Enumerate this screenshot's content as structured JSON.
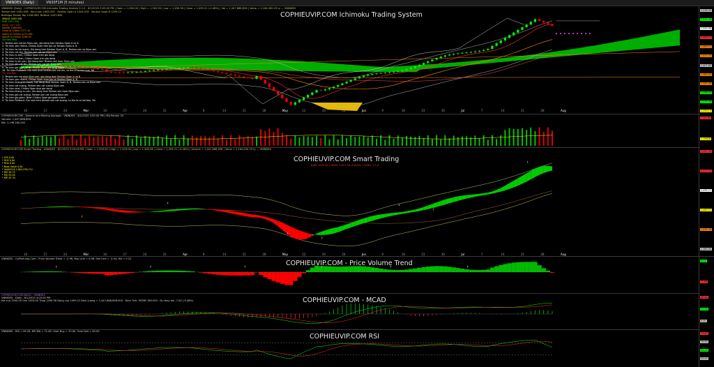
{
  "tabs": [
    "VNINDEX (Daily)",
    "VN30F1M (5 minutes)"
  ],
  "panels": {
    "ichimoku": {
      "watermark": "COPHIEUVIP.COM Ichimoku Trading System",
      "header": [
        "VNINDEX (Daily) - COPHIEUVIP.COM Ichimoku Trading System 9.1.0 - 8/1/2025 3:05:00 PM | Open = 1,500.00 | High = 1,503.00 | Low = 1,490.56 | Close = 1,495.21 (-0.48%) | Vol = 1,447,888,856 | Value = 2,164,000.25 ty — VNINDEX",
        "Tenkan-sen 1500.556   Kijun-sen 1463.505   Senkou Span A 1343.476   Senkou Span B 1250.13",
        "Bollinger Bands Top 1538.989  Bottom 1407.845"
      ],
      "legend": [
        {
          "text": "SMA20 1463.336",
          "color": "#ffff00"
        },
        {
          "text": "EMA 1511.338",
          "color": "#00ff00"
        },
        {
          "text": "MA50 1417.434",
          "color": "#ff4040"
        },
        {
          "text": "MA200 1360.645",
          "color": "#ff8c00"
        },
        {
          "text": "Close Al Chikou 1377.44",
          "color": "#ff8c00"
        },
        {
          "text": "Spann Al Chikou 1271.585",
          "color": "#ff8c00"
        },
        {
          "text": "SpanB Al Chikou 1298.35",
          "color": "#ff8c00"
        },
        {
          "text": "Tin hieu Mua",
          "color": "#00ff00"
        },
        {
          "text": "1. Tenkan-sen cat len Kijun-sen, gia dong tren Senkou Span A va B",
          "color": "#ffffff"
        },
        {
          "text": "2. Tin hieu yeu nhanh, Chikou Span tren gia va Senkou Span A, B",
          "color": "#ffffff"
        },
        {
          "text": "3. Tin hieu ho tro manh, Gia dong tren Senkou Span A, B, Tenkan-sen va Kijun-sen",
          "color": "#ffffff"
        },
        {
          "text": "4. Tin hieu cat len, Tenkan-sen cat len Kijun-sen",
          "color": "#ffffff"
        },
        {
          "text": "5. Tin hieu tu tren, Chikou Span tren gia dong",
          "color": "#ffffff"
        },
        {
          "text": "6. Tin hieu tru tien, Chikou Span tren gia dong",
          "color": "#ffffff"
        },
        {
          "text": "7. Tin hieu tu tru yeu, Gia dong tren Tenkan-sen hoac Kijun-sen",
          "color": "#ffffff"
        },
        {
          "text": "8. Tin hieu gia cat len, Tenkan-sen cat len Kijun-sen",
          "color": "#ffffff"
        },
        {
          "text": "9. Tin hieu gia vuot, Nhan Chikou Span gia tang manh",
          "color": "#ffffff"
        },
        {
          "text": "10. Tin hieu Pullback: Gia nam duoi tenkan-sen cat len, co the la co hoi mua, No",
          "color": "#ffffff"
        },
        {
          "text": "Tin hieu Ban",
          "color": "#ff3030"
        },
        {
          "text": "1. Tenkan-sen cat duoi Kijun-sen, gia dong duoi Senkou Span A va B",
          "color": "#ffffff"
        },
        {
          "text": "2. Tin hieu yeu nhanh, Chikou Span duoi gia va Senkou Span A, B",
          "color": "#ffffff"
        },
        {
          "text": "3. Tin hieu khang cu manh, Gia dong duoi Senkou Span A, B, Tenkan-sen va Kijun-sen",
          "color": "#ffffff"
        },
        {
          "text": "4. Tin hieu cat xuong, Tenkan-sen cat xuong Kijun-sen",
          "color": "#ffffff"
        },
        {
          "text": "5. Tin hieu duoi, Chikou Span duoi gia dong",
          "color": "#ffffff"
        },
        {
          "text": "6. Tin hieu khang cu yeu, Gia dong duoi Tenkan-sen hoac Kijun-sen",
          "color": "#ffffff"
        },
        {
          "text": "7. Tin hieu gia cat xuong, Tenkan-sen cat xuong Kijun-sen",
          "color": "#ffffff"
        },
        {
          "text": "8. Tin hieu gia giam, Nhan Chikou Span gia giam manh",
          "color": "#ffffff"
        },
        {
          "text": "9. Tin hieu Pullback: Gia nam tren tenkan-sen cat xuong, co the la co hoi ban, No",
          "color": "#ffffff"
        }
      ],
      "price_labels": [
        {
          "text": "1,538.99",
          "color": "#c0c0c0"
        },
        {
          "text": "1,511.34",
          "color": "#00ff00"
        },
        {
          "text": "1,500.56",
          "color": "#ffffff"
        },
        {
          "text": "1,495.21",
          "color": "#ff3030"
        },
        {
          "text": "1,463.51",
          "color": "#ff8c00"
        },
        {
          "text": "1,417.43",
          "color": "#ff8c00"
        },
        {
          "text": "1,407.85",
          "color": "#c0c0c0"
        },
        {
          "text": "1,360.65",
          "color": "#ff8c00"
        },
        {
          "text": "1,343.48",
          "color": "#ff8c00"
        },
        {
          "text": "1,298.35",
          "color": "#00ff00"
        },
        {
          "text": "1,271.59",
          "color": "#00ff00"
        },
        {
          "text": "1,250.13",
          "color": "#ffff00"
        }
      ]
    },
    "volume": {
      "header": "COPHIEUVIP.COM - Volume and Moving Average - VNINDEX - 8/1/2025 3:05:00 PM | MA Period: 20",
      "line2": "Volume: 1,447,888,856",
      "line3": "MA: 1,196,180,002",
      "labels": [
        {
          "text": "1.4478B",
          "color": "#ff3030"
        },
        {
          "text": "1.1962B",
          "color": "#ffff00"
        }
      ]
    },
    "smart": {
      "watermark": "COPHIEUVIP.COM Smart Trading",
      "subtitle": "BAN: 1525.45 | GIAM: 1,517.54 (9 diem) | LANH: 1,5,5",
      "header": "COPHIEUVIP.COM Smart Trading - VNINDEX - 8/1/2025 3:05:00 PM | Open = 1,500.00 | High = 1,503.00 | Low = 1,490.56 | Close = 1,495.21 (-0.48%) | Volume = 1,447,888,856 | Value = 2,164,000.25 ty — VNINDEX",
      "stats": [
        {
          "text": "* EPS   0.00",
          "color": "#ffff00"
        },
        {
          "text": "* ROE   0.00",
          "color": "#ffff00"
        },
        {
          "text": "* ROA   0.00",
          "color": "#ffff00"
        },
        {
          "text": "* Book Value   0.00",
          "color": "#ffff00"
        },
        {
          "text": "* VolAVG20  1,602,976,712",
          "color": "#ffff00"
        },
        {
          "text": "* MFI   61.72",
          "color": "#ffff00"
        },
        {
          "text": "* RSI   59.28",
          "color": "#ffff00"
        },
        {
          "text": "* MFI   67.34",
          "color": "#ffff00"
        }
      ],
      "labels": [
        {
          "text": "1,541.54",
          "color": "#ff3030"
        },
        {
          "text": "1,517.54",
          "color": "#ff3030"
        },
        {
          "text": "1,495.21",
          "color": "#ffffff"
        },
        {
          "text": "1,463.51",
          "color": "#ffff00"
        },
        {
          "text": "1,432.26",
          "color": "#ff8c00"
        },
        {
          "text": "1,380.00",
          "color": "#c0c0c0"
        }
      ]
    },
    "pvt": {
      "watermark": "COPHIEUVIP.COM - Price Volume Trend",
      "header": "VNINDEX - CoPhieuVip.Com - Price Volume Trend = -2.96, Buy Line = 0.06, Sell Line = -0.04, MA = 0.22",
      "labels": [
        {
          "text": "0.22",
          "color": "#00ff00"
        },
        {
          "text": "-2.96",
          "color": "#ff3030"
        }
      ]
    },
    "macd": {
      "watermark": "COPHIEUVIP.COM - MCAD",
      "header": "COPHIEUVIP.COM MACD - VNINDEX",
      "line2": "VNINDEX - Daily - 8/1/2025 3:05:00 PM",
      "line3": "Mo cua 1500.00 Cao 1503.00 Thap 1490.56 Dong cua 1495.21 Khoi Luong = 1,447,888,856.000 - Dien Tich: MCBM 180.000 - Du thay doi -7.00 (-0.48%)",
      "labels": [
        {
          "text": "30.84",
          "color": "#ff3030"
        },
        {
          "text": "27.05",
          "color": "#00ff00"
        },
        {
          "text": "0.00",
          "color": "#c0c0c0"
        }
      ]
    },
    "rsi": {
      "watermark": "COPHIEUVIP.COM RSI",
      "header": "VNINDEX - RSI = 59.25, RSI MA = 71.65, Over Buy = 70.00, Over Sell = 30.00",
      "labels": [
        {
          "text": "71.65",
          "color": "#ff3030"
        },
        {
          "text": "70.00",
          "color": "#c0c0c0"
        },
        {
          "text": "59.25",
          "color": "#00ff00"
        },
        {
          "text": "30.00",
          "color": "#c0c0c0"
        }
      ]
    }
  },
  "date_axis": [
    "10",
    "17",
    "24",
    "Mar",
    "10",
    "17",
    "24",
    "31",
    "Apr",
    "9",
    "14",
    "21",
    "28",
    "May",
    "12",
    "19",
    "26",
    "Jun",
    "9",
    "16",
    "23",
    "30",
    "Jul",
    "7",
    "14",
    "21",
    "28",
    "Aug"
  ],
  "colors": {
    "bull": "#00ff00",
    "bear": "#ff0000",
    "cloud": "#00cc00",
    "tenkan": "#ff3030",
    "kijun": "#ff8c00"
  }
}
